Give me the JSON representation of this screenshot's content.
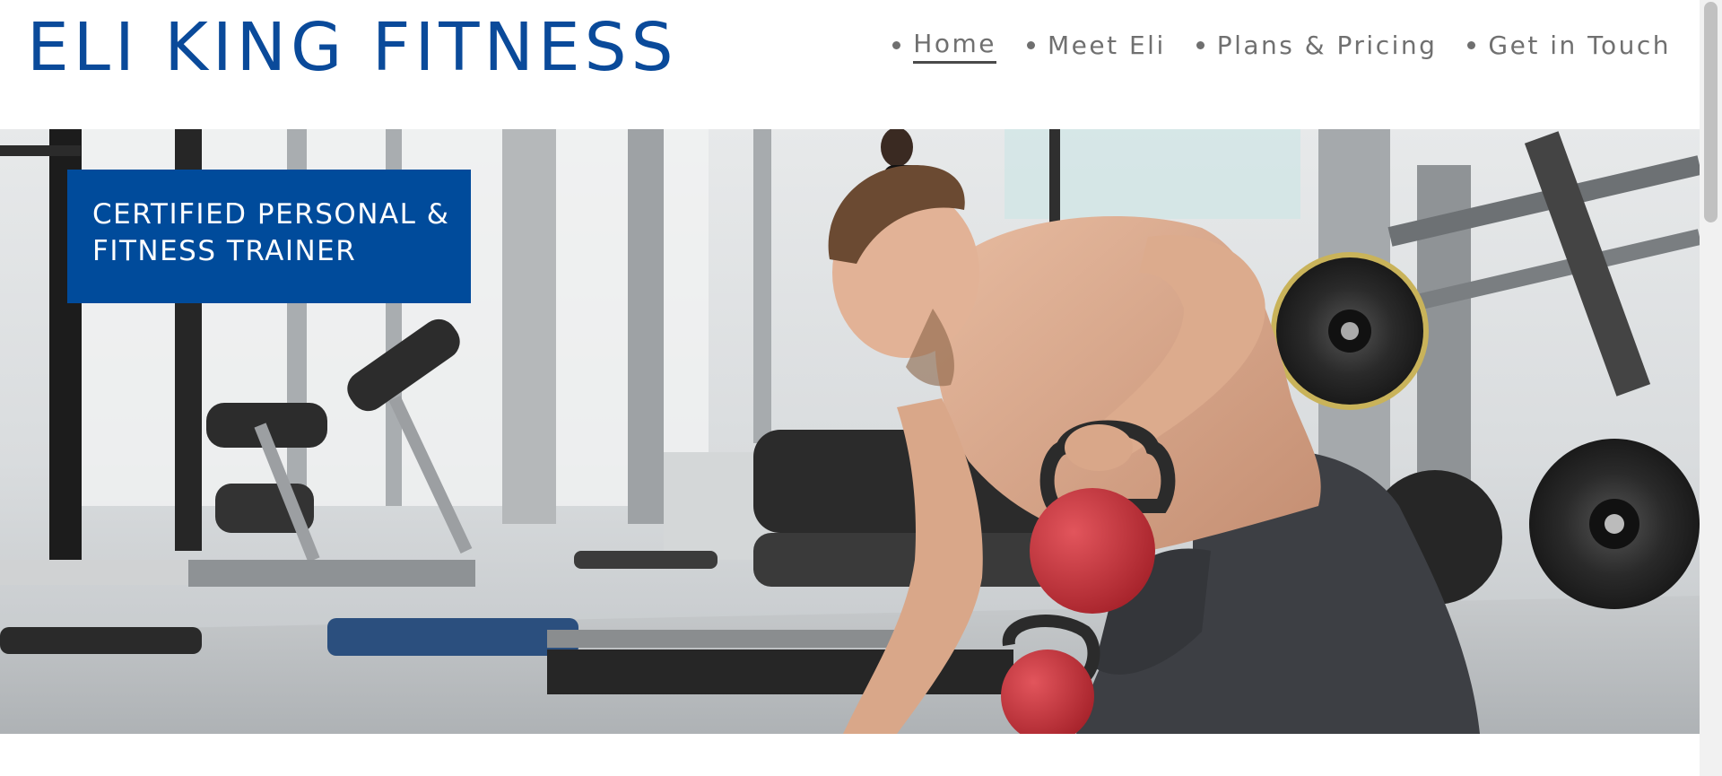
{
  "site": {
    "title": "ELI KING FITNESS"
  },
  "nav": {
    "items": [
      {
        "label": "Home",
        "active": true
      },
      {
        "label": "Meet Eli",
        "active": false
      },
      {
        "label": "Plans & Pricing",
        "active": false
      },
      {
        "label": "Get in Touch",
        "active": false
      }
    ]
  },
  "hero": {
    "badge_line_1": "CERTIFIED PERSONAL &",
    "badge_line_2": "FITNESS TRAINER",
    "image_subject": "man-lifting-red-kettlebell-in-gym"
  },
  "colors": {
    "brand_blue": "#0a4a9a",
    "badge_blue": "#004b9b",
    "nav_text": "#707070",
    "background": "#ffffff"
  }
}
